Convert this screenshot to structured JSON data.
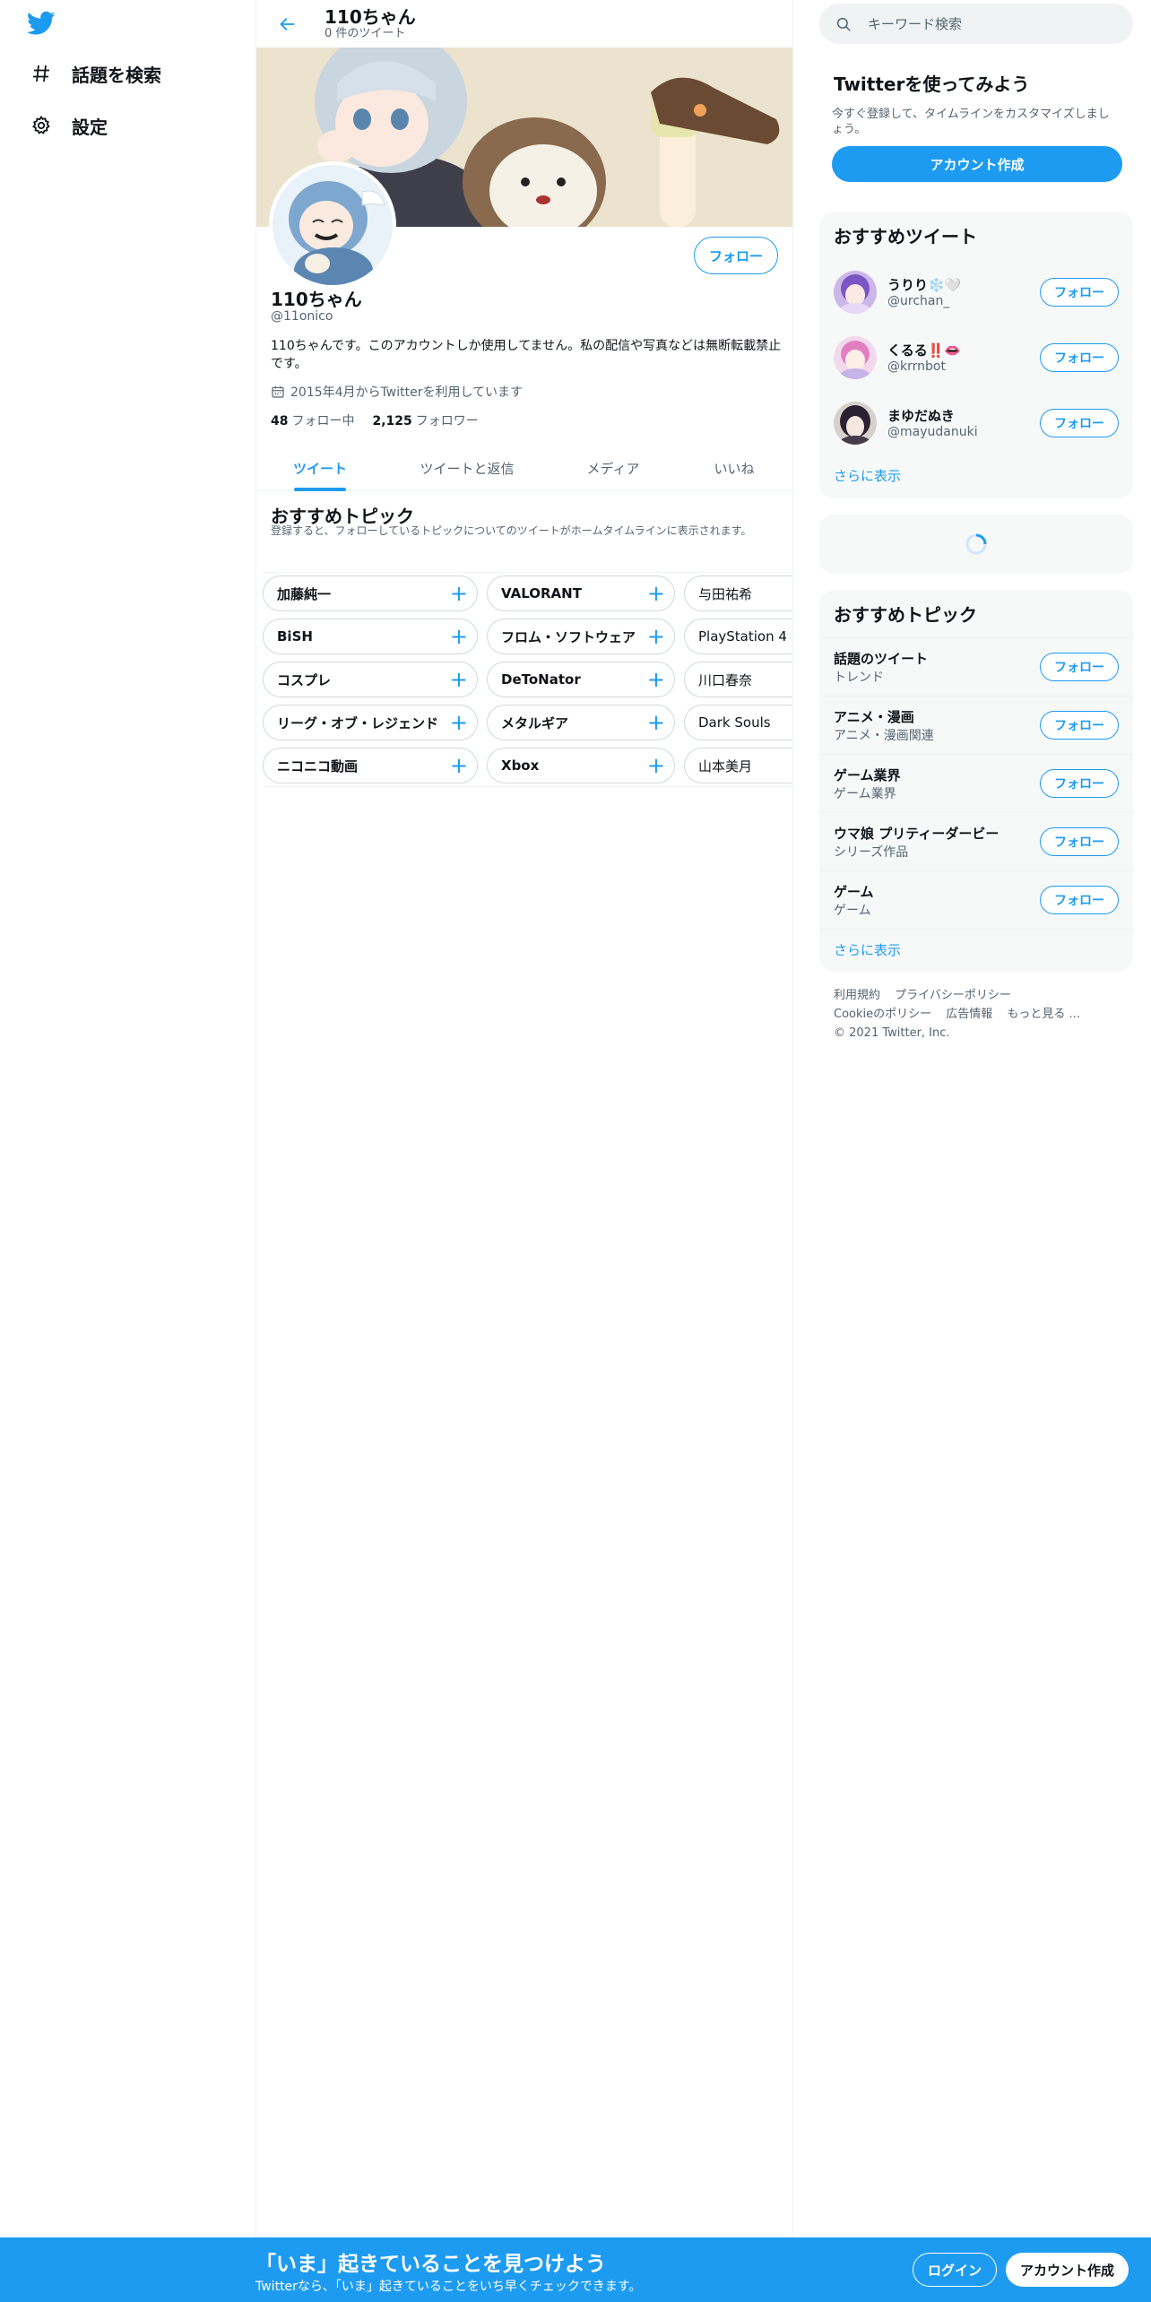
{
  "colors": {
    "accent": "#1d9bf0",
    "text": "#0f1419",
    "muted": "#536471",
    "panel": "#f7f9f9"
  },
  "nav": {
    "items": [
      {
        "label": "話題を検索",
        "icon": "hashtag-icon"
      },
      {
        "label": "設定",
        "icon": "gear-icon"
      }
    ]
  },
  "header": {
    "name": "110ちゃん",
    "tweet_count": "0 件のツイート"
  },
  "profile": {
    "follow_label": "フォロー",
    "name": "110ちゃん",
    "handle": "@11onico",
    "bio": "110ちゃんです。このアカウントしか使用してません。私の配信や写真などは無断転載禁止です。",
    "joined": "2015年4月からTwitterを利用しています",
    "following_count": "48",
    "following_label": "フォロー中",
    "followers_count": "2,125",
    "followers_label": "フォロワー"
  },
  "tabs": [
    {
      "label": "ツイート",
      "active": true
    },
    {
      "label": "ツイートと返信",
      "active": false
    },
    {
      "label": "メディア",
      "active": false
    },
    {
      "label": "いいね",
      "active": false
    }
  ],
  "topics": {
    "title": "おすすめトピック",
    "subtitle": "登録すると、フォローしているトピックについてのツイートがホームタイムラインに表示されます。",
    "chips": [
      "加藤純一",
      "VALORANT",
      "与田祐希",
      "BiSH",
      "フロム・ソフトウェア",
      "PlayStation 4",
      "コスプレ",
      "DeToNator",
      "川口春奈",
      "リーグ・オブ・レジェンド",
      "メタルギア",
      "Dark Souls",
      "ニコニコ動画",
      "Xbox",
      "山本美月"
    ]
  },
  "search": {
    "placeholder": "キーワード検索"
  },
  "signup_card": {
    "title": "Twitterを使ってみよう",
    "desc": "今すぐ登録して、タイムラインをカスタマイズしましょう。",
    "button": "アカウント作成"
  },
  "who_to_follow": {
    "title": "おすすめツイート",
    "users": [
      {
        "name": "うりり❄️🤍",
        "handle": "@urchan_",
        "follow": "フォロー"
      },
      {
        "name": "くるる‼️👄",
        "handle": "@krrnbot",
        "follow": "フォロー"
      },
      {
        "name": "まゆだぬき",
        "handle": "@mayudanuki",
        "follow": "フォロー"
      }
    ],
    "show_more": "さらに表示"
  },
  "rec_topics": {
    "title": "おすすめトピック",
    "items": [
      {
        "name": "話題のツイート",
        "category": "トレンド",
        "follow": "フォロー"
      },
      {
        "name": "アニメ・漫画",
        "category": "アニメ・漫画関連",
        "follow": "フォロー"
      },
      {
        "name": "ゲーム業界",
        "category": "ゲーム業界",
        "follow": "フォロー"
      },
      {
        "name": "ウマ娘 プリティーダービー",
        "category": "シリーズ作品",
        "follow": "フォロー"
      },
      {
        "name": "ゲーム",
        "category": "ゲーム",
        "follow": "フォロー"
      }
    ],
    "show_more": "さらに表示"
  },
  "footer": {
    "links": [
      "利用規約",
      "プライバシーポリシー",
      "Cookieのポリシー",
      "広告情報",
      "もっと見る ..."
    ],
    "copyright": "© 2021 Twitter, Inc."
  },
  "bottom_bar": {
    "title": "「いま」起きていることを見つけよう",
    "subtitle": "Twitterなら、「いま」起きていることをいち早くチェックできます。",
    "login": "ログイン",
    "signup": "アカウント作成"
  }
}
